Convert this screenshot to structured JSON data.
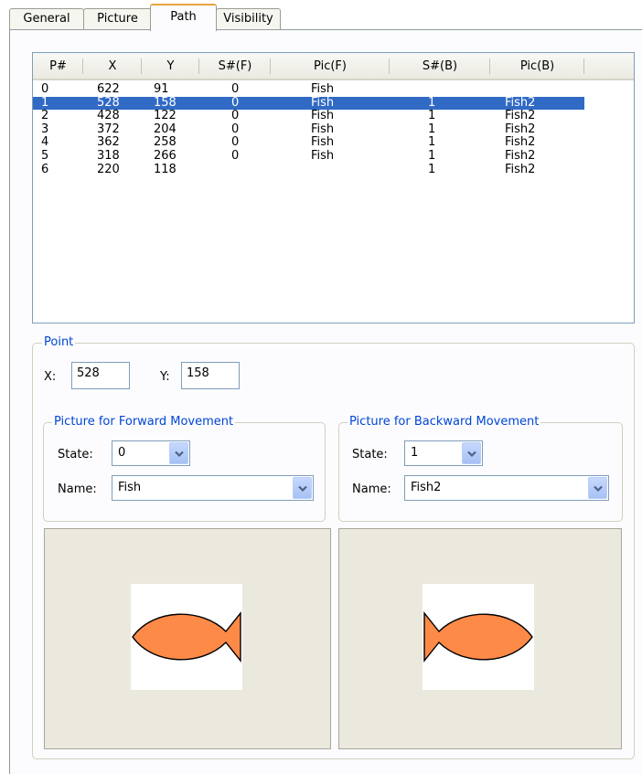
{
  "tabs": [
    "General",
    "Picture",
    "Path",
    "Visibility"
  ],
  "list": {
    "columns": [
      "P#",
      "X",
      "Y",
      "S#(F)",
      "Pic(F)",
      "S#(B)",
      "Pic(B)"
    ],
    "rows": [
      [
        "0",
        "622",
        "91",
        "0",
        "Fish",
        "",
        ""
      ],
      [
        "1",
        "528",
        "158",
        "0",
        "Fish",
        "1",
        "Fish2"
      ],
      [
        "2",
        "428",
        "122",
        "0",
        "Fish",
        "1",
        "Fish2"
      ],
      [
        "3",
        "372",
        "204",
        "0",
        "Fish",
        "1",
        "Fish2"
      ],
      [
        "4",
        "362",
        "258",
        "0",
        "Fish",
        "1",
        "Fish2"
      ],
      [
        "5",
        "318",
        "266",
        "0",
        "Fish",
        "1",
        "Fish2"
      ],
      [
        "6",
        "220",
        "118",
        "",
        "",
        "1",
        "Fish2"
      ]
    ]
  },
  "point": {
    "title": "Point",
    "x_label": "X:",
    "x_value": "528",
    "y_label": "Y:",
    "y_value": "158"
  },
  "forward": {
    "title": "Picture for Forward Movement",
    "state_label": "State:",
    "state_value": "0",
    "name_label": "Name:",
    "name_value": "Fish"
  },
  "backward": {
    "title": "Picture for Backward Movement",
    "state_label": "State:",
    "state_value": "1",
    "name_label": "Name:",
    "name_value": "Fish2"
  },
  "colors": {
    "selection": "#316ac5",
    "group_title": "#0046d5",
    "fish_fill": "#fe8a48",
    "preview_bg": "#ebe9dd"
  },
  "icons": {
    "fish_forward": "fish-facing-left-icon",
    "fish_backward": "fish-facing-right-icon"
  }
}
